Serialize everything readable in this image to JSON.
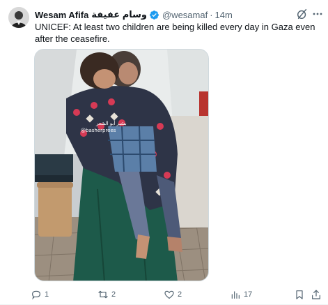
{
  "author": {
    "name": "Wesam Afifa",
    "name_ar": "وسام عفيفة",
    "handle": "@wesamaf",
    "separator": "·",
    "time": "14m",
    "avatar_icon": "person-avatar",
    "verified_icon": "verified-badge-icon",
    "verified_color": "#1d9bf0"
  },
  "tweet": {
    "text": "UNICEF: At least two children are being killed every day in Gaza even after the ceasefire."
  },
  "media": {
    "watermark_ar": "بشير أبو الشعر",
    "watermark_handle": "@basherprees"
  },
  "actions": {
    "reply_count": "1",
    "retweet_count": "2",
    "like_count": "2",
    "views_count": "17"
  },
  "colors": {
    "text": "#0f1419",
    "muted": "#536471",
    "accent": "#1d9bf0"
  }
}
